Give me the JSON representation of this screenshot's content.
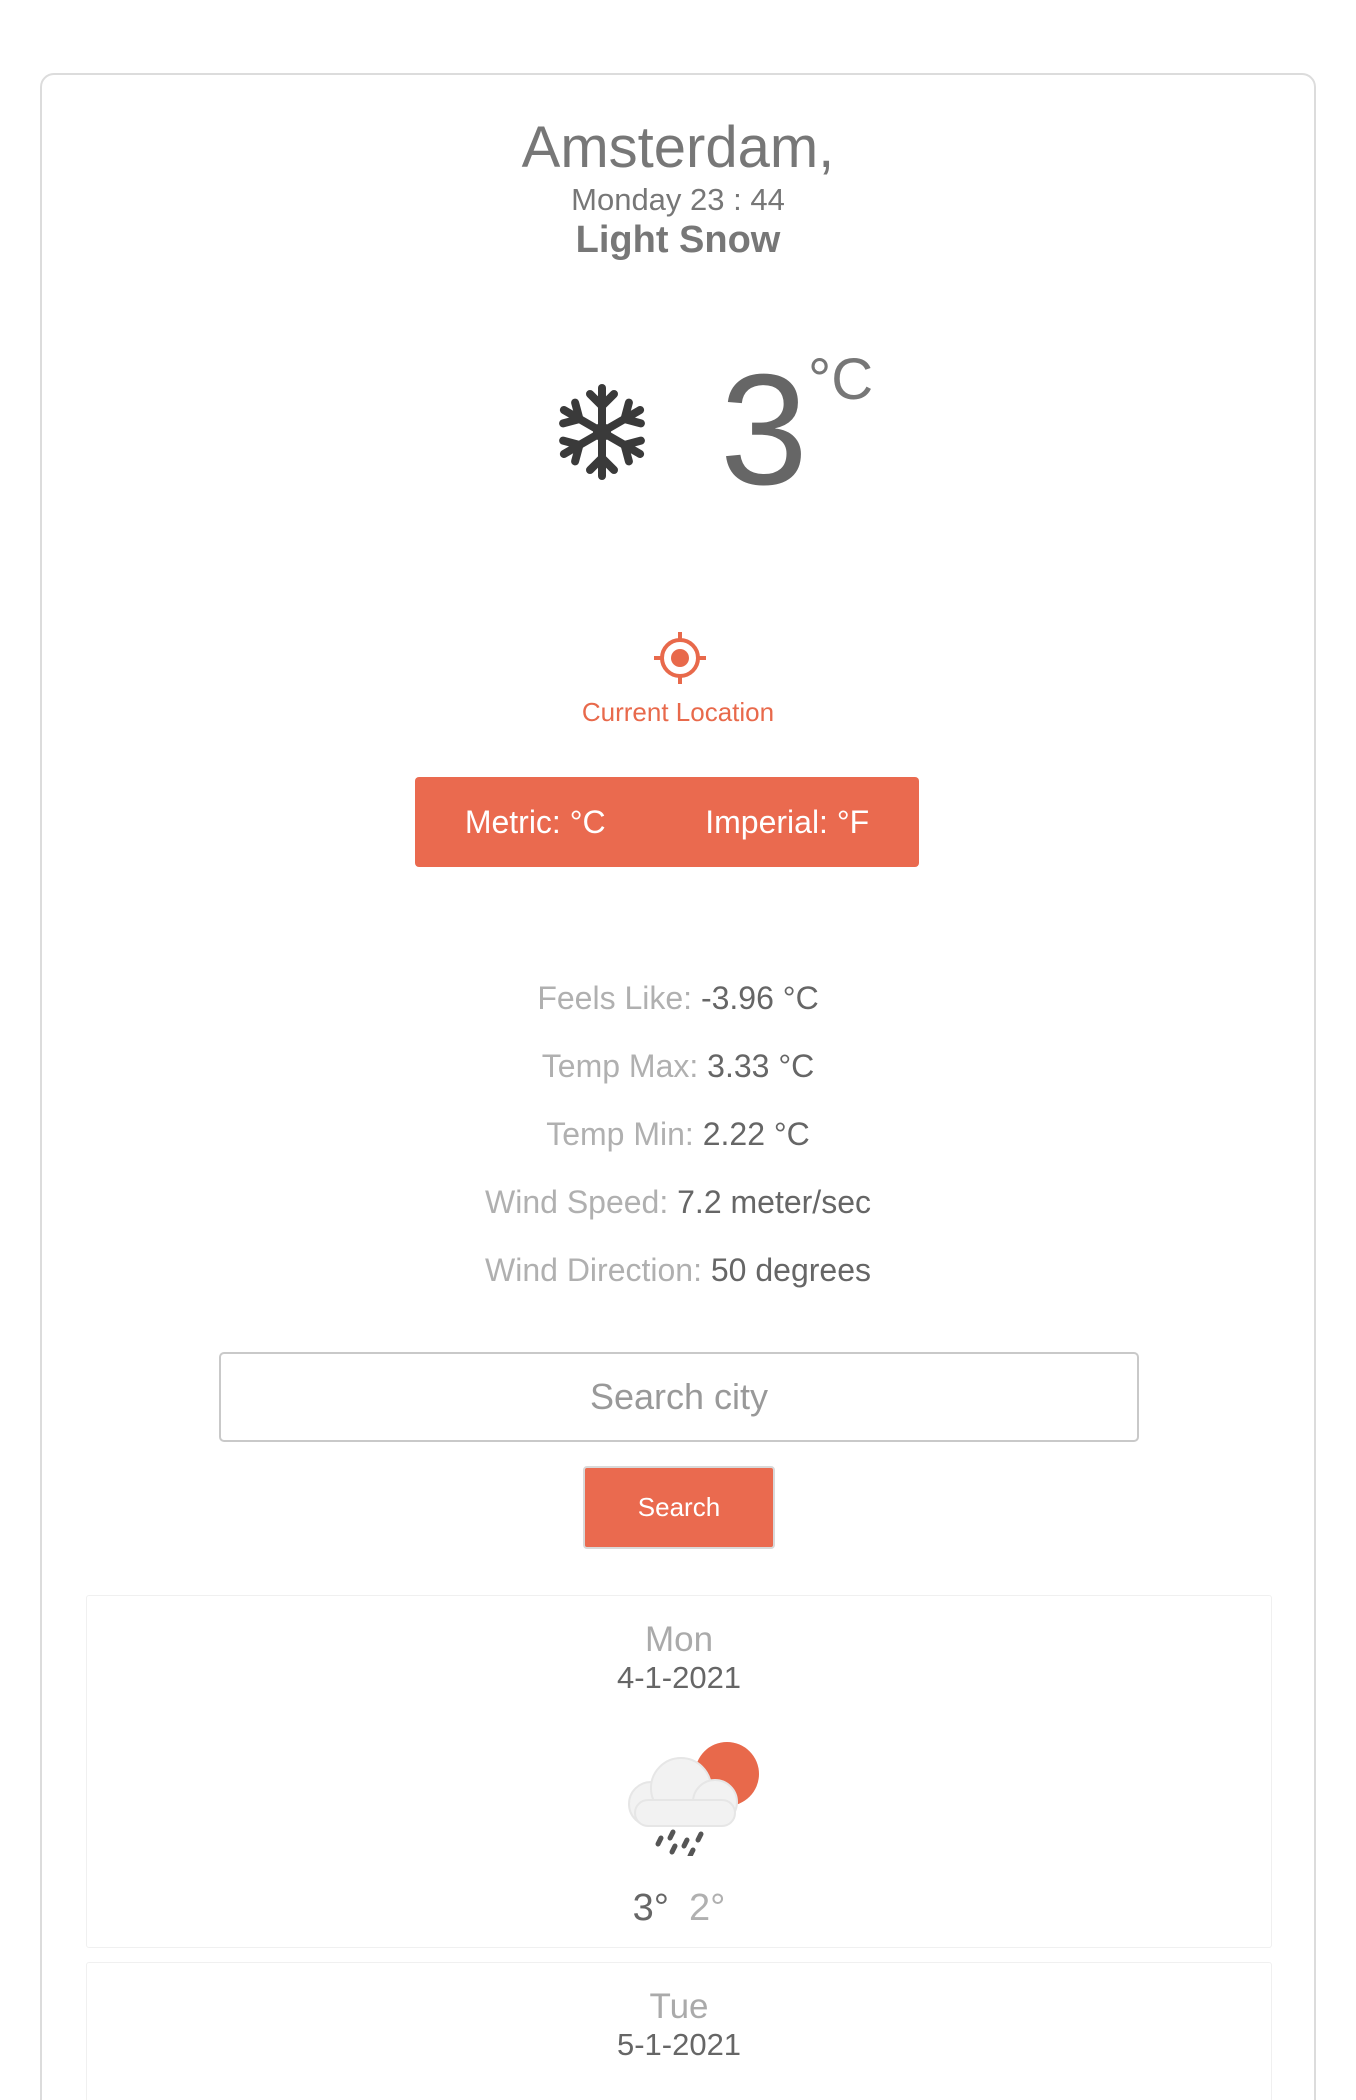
{
  "location": {
    "city": "Amsterdam,",
    "datetime": "Monday 23 : 44",
    "condition": "Light Snow"
  },
  "current": {
    "temperature": "3",
    "unit": "°C",
    "icon": "snowflake-icon"
  },
  "current_location": {
    "label": "Current Location",
    "icon": "crosshair-icon"
  },
  "units_toggle": {
    "metric_label": "Metric: °C",
    "imperial_label": "Imperial: °F"
  },
  "details": [
    {
      "label": "Feels Like:",
      "value": "-3.96 °C"
    },
    {
      "label": "Temp Max:",
      "value": "3.33 °C"
    },
    {
      "label": "Temp Min:",
      "value": "2.22 °C"
    },
    {
      "label": "Wind Speed:",
      "value": "7.2 meter/sec"
    },
    {
      "label": "Wind Direction:",
      "value": "50 degrees"
    }
  ],
  "search": {
    "placeholder": "Search city",
    "value": "",
    "button_label": "Search"
  },
  "forecast": [
    {
      "day": "Mon",
      "date": "4-1-2021",
      "icon": "sun-cloud-rain-icon",
      "high": "3°",
      "low": "2°"
    },
    {
      "day": "Tue",
      "date": "5-1-2021"
    }
  ],
  "colors": {
    "accent": "#ea6a4f",
    "text_primary": "#666666",
    "text_secondary": "#b0b0b0",
    "border": "#dcdcdc"
  }
}
